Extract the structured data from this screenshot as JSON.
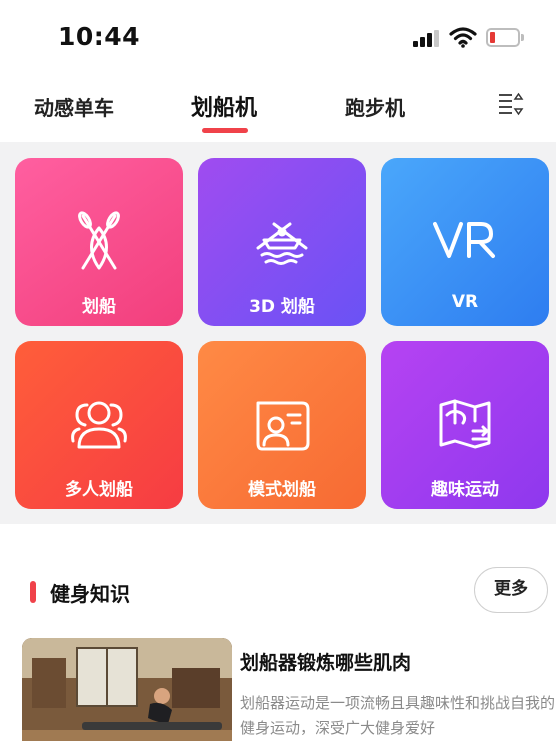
{
  "status_bar": {
    "time": "10:44"
  },
  "tabs": [
    {
      "label": "动感单车",
      "active": false
    },
    {
      "label": "划船机",
      "active": true
    },
    {
      "label": "跑步机",
      "active": false
    }
  ],
  "tiles": [
    {
      "label": "划船",
      "icon": "paddles-icon",
      "color": "#f23f7c"
    },
    {
      "label": "3D 划船",
      "icon": "rowing-boat-icon",
      "color": "#6a52f5"
    },
    {
      "label": "VR",
      "icon": "vr-icon",
      "color": "#2e7df0"
    },
    {
      "label": "多人划船",
      "icon": "group-icon",
      "color": "#f63c43"
    },
    {
      "label": "模式划船",
      "icon": "profile-card-icon",
      "color": "#f76a33"
    },
    {
      "label": "趣味运动",
      "icon": "map-icon",
      "color": "#8e38ee"
    }
  ],
  "knowledge": {
    "title": "健身知识",
    "more_label": "更多",
    "article": {
      "title": "划船器锻炼哪些肌肉",
      "description": "划船器运动是一项流畅且具趣味性和挑战自我的健身运动，深受广大健身爱好"
    }
  },
  "accent_color": "#f0424a"
}
